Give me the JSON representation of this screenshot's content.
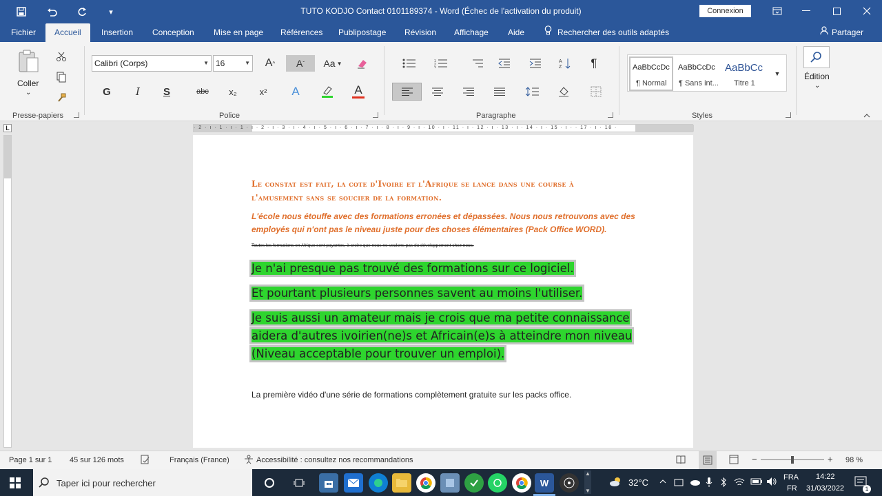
{
  "titlebar": {
    "title": "TUTO KODJO Contact  0101189374  -  Word (Échec de l'activation du produit)",
    "signin": "Connexion",
    "qa_more": "▾"
  },
  "tabs": [
    "Fichier",
    "Accueil",
    "Insertion",
    "Conception",
    "Mise en page",
    "Références",
    "Publipostage",
    "Révision",
    "Affichage",
    "Aide"
  ],
  "tellme": "Rechercher des outils adaptés",
  "share": "Partager",
  "ribbon": {
    "clipboard": {
      "paste": "Coller",
      "paste_arrow": "⌄",
      "label": "Presse-papiers"
    },
    "font": {
      "name": "Calibri (Corps)",
      "size": "16",
      "label": "Police",
      "grow": "A",
      "shrink": "A",
      "case": "Aa",
      "bold": "G",
      "italic": "I",
      "underline": "S",
      "strike": "abc",
      "sub": "x₂",
      "sup": "x²",
      "effects": "A",
      "color": "A"
    },
    "paragraph": {
      "label": "Paragraphe",
      "pilcrow": "¶"
    },
    "styles": {
      "label": "Styles",
      "items": [
        {
          "preview": "AaBbCcDc",
          "name": "¶ Normal"
        },
        {
          "preview": "AaBbCcDc",
          "name": "¶ Sans int..."
        },
        {
          "preview": "AaBbCc",
          "name": "Titre 1"
        }
      ]
    },
    "editing": {
      "label": "Édition",
      "arrow": "⌄"
    }
  },
  "ruler": {
    "numbers": "· 2 · ı · 1 · ı · 1 · ı · 2 · ı · 3 · ı · 4 · ı · 5 · ı · 6 · ı · 7 · ı · 8 · ı · 9 · ı · 10 · ı · 11 · ı · 12 · ı · 13 · ı · 14 · ı · 15 · ı ·   · 17 · ı · 18 ·",
    "tab_marker": "L"
  },
  "document": {
    "heading": [
      "Le constat est fait, la cote d'Ivoire et l'Afrique se lance dans une course à",
      "l'amusement sans se soucier de la formation."
    ],
    "italic": [
      "L'école nous étouffe avec des formations erronées et dépassées. Nous nous retrouvons avec des",
      "employés qui n'ont pas le niveau juste pour des choses élémentaires (Pack Office WORD)."
    ],
    "strike": "Toutes les formations en Afrique sont payantes, à croire que nous ne voulons pas du développement chez nous.",
    "highlight": [
      "Je n'ai presque pas trouvé des formations sur ce logiciel.",
      "Et pourtant plusieurs personnes savent au moins l'utiliser.",
      "Je suis aussi un amateur mais je crois que ma petite connaissance",
      "aidera d'autres ivoirien(ne)s et Africain(e)s à atteindre mon niveau",
      "(Niveau acceptable pour trouver un emploi)."
    ],
    "plain": "La première vidéo d'une série de formations complètement gratuite sur les packs office."
  },
  "status": {
    "page": "Page 1 sur 1",
    "words": "45 sur 126 mots",
    "lang": "Français (France)",
    "access": "Accessibilité : consultez nos recommandations",
    "zoom": "98 %",
    "zoom_level": 0.98,
    "zoom_minus": "−",
    "zoom_plus": "+"
  },
  "taskbar": {
    "search": "Taper ici pour rechercher",
    "temp": "32°C",
    "lang1": "FRA",
    "lang2": "FR",
    "time": "14:22",
    "date": "31/03/2022",
    "notif": "1",
    "word_letter": "W"
  },
  "colors": {
    "word_blue": "#2b579a",
    "heading_orange": "#e06f2c",
    "highlight_green": "#2ed52e"
  }
}
